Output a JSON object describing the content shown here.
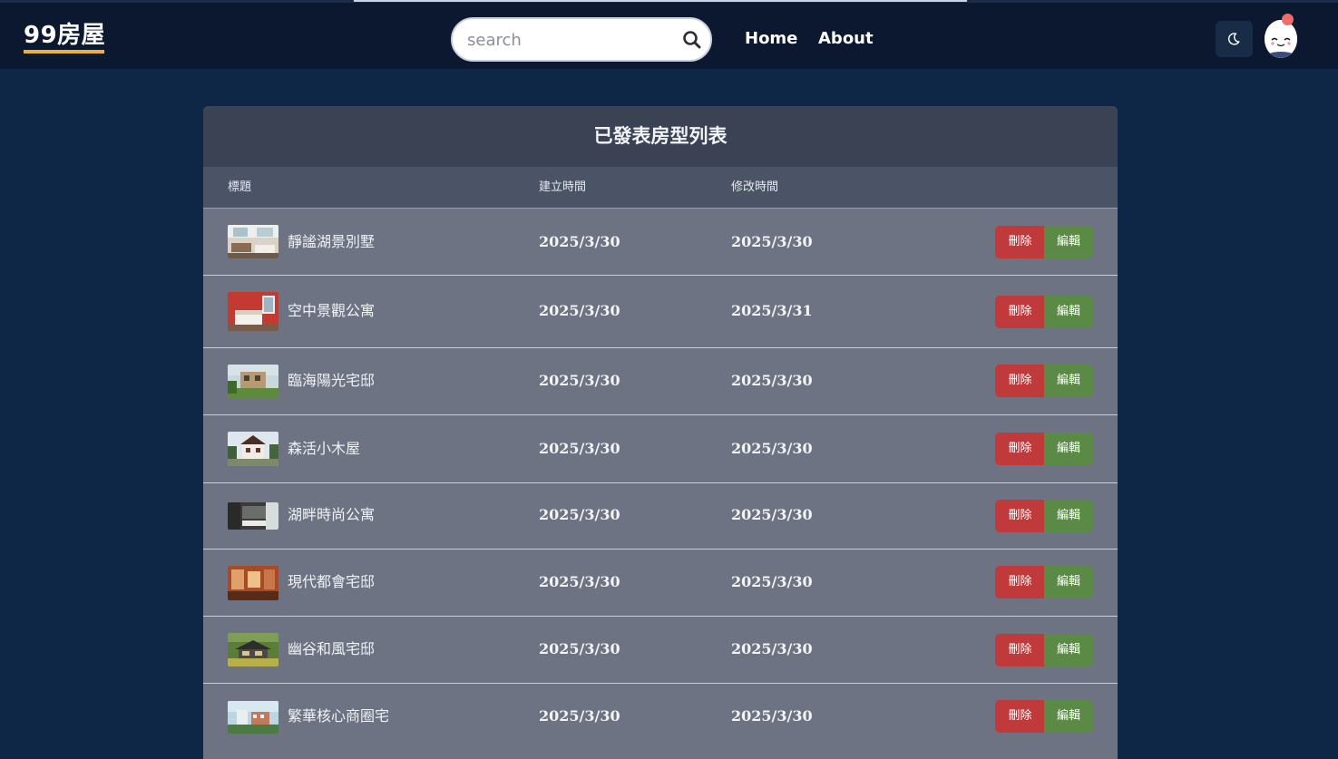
{
  "nav": {
    "logo": "99房屋",
    "search_placeholder": "search",
    "links": [
      "Home",
      "About"
    ]
  },
  "icons": {
    "search": "search-icon",
    "theme": "moon-icon",
    "avatar": "avatar-icon"
  },
  "colors": {
    "page_bg": "#0f2746",
    "nav_bg": "#0c1830",
    "logo_accent": "#e9b23c",
    "panel_header": "#3a4253",
    "table_head": "#4b5466",
    "row_bg": "#6d7382",
    "delete": "#c0393b",
    "edit": "#5a8a45",
    "notify_dot": "#f16b6b"
  },
  "panel": {
    "title": "已發表房型列表",
    "columns": [
      "標題",
      "建立時間",
      "修改時間"
    ],
    "rows": [
      {
        "title": "靜謐湖景別墅",
        "created": "2025/3/30",
        "modified": "2025/3/30",
        "delete_label": "刪除",
        "edit_label": "編輯"
      },
      {
        "title": "空中景觀公寓",
        "created": "2025/3/30",
        "modified": "2025/3/31",
        "delete_label": "刪除",
        "edit_label": "編輯"
      },
      {
        "title": "臨海陽光宅邸",
        "created": "2025/3/30",
        "modified": "2025/3/30",
        "delete_label": "刪除",
        "edit_label": "編輯"
      },
      {
        "title": "森活小木屋",
        "created": "2025/3/30",
        "modified": "2025/3/30",
        "delete_label": "刪除",
        "edit_label": "編輯"
      },
      {
        "title": "湖畔時尚公寓",
        "created": "2025/3/30",
        "modified": "2025/3/30",
        "delete_label": "刪除",
        "edit_label": "編輯"
      },
      {
        "title": "現代都會宅邸",
        "created": "2025/3/30",
        "modified": "2025/3/30",
        "delete_label": "刪除",
        "edit_label": "編輯"
      },
      {
        "title": "幽谷和風宅邸",
        "created": "2025/3/30",
        "modified": "2025/3/30",
        "delete_label": "刪除",
        "edit_label": "編輯"
      },
      {
        "title": "繁華核心商圈宅",
        "created": "2025/3/30",
        "modified": "2025/3/30",
        "delete_label": "刪除",
        "edit_label": "編輯"
      }
    ]
  }
}
